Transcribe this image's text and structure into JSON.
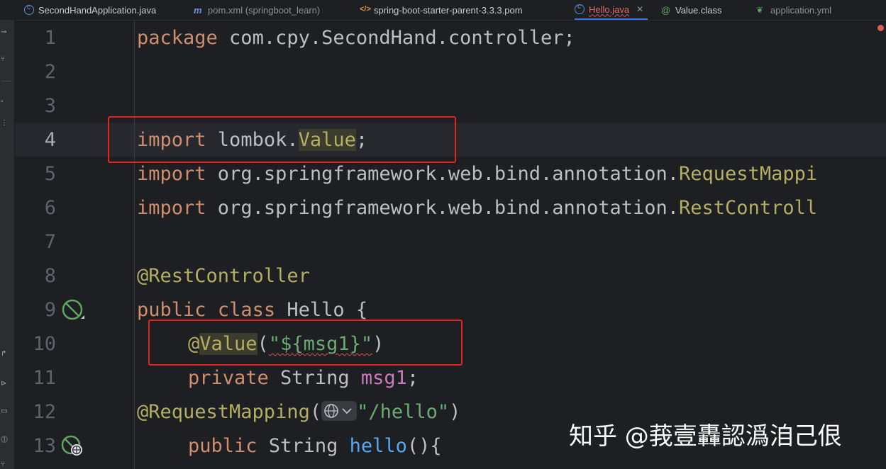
{
  "tabs": [
    {
      "label": "SecondHandApplication.java",
      "icon": "class-icon",
      "color": "#c9ccd3"
    },
    {
      "label": "pom.xml (springboot_learn)",
      "icon": "maven-icon",
      "color": "#8c8f96"
    },
    {
      "label": "spring-boot-starter-parent-3.3.3.pom",
      "icon": "xml-icon",
      "color": "#c9ccd3"
    },
    {
      "label": "Hello.java",
      "icon": "class-icon",
      "color": "#e06c6c",
      "close": "✕"
    },
    {
      "label": "Value.class",
      "icon": "annotation-icon",
      "color": "#c9ccd3"
    },
    {
      "label": "application.yml",
      "icon": "spring-leaf-icon",
      "color": "#8c8f96"
    }
  ],
  "line_numbers": [
    "1",
    "2",
    "3",
    "4",
    "5",
    "6",
    "7",
    "8",
    "9",
    "10",
    "11",
    "12",
    "13"
  ],
  "code": {
    "l1": {
      "kw": "package",
      "rest": " com.cpy.SecondHand.controller;"
    },
    "l4": {
      "kw": "import",
      "mid": " lombok.",
      "cls": "Value",
      "end": ";"
    },
    "l5": {
      "kw": "import",
      "mid": " org.springframework.web.bind.annotation.",
      "cls": "RequestMappi"
    },
    "l6": {
      "kw": "import",
      "mid": " org.springframework.web.bind.annotation.",
      "cls": "RestControll"
    },
    "l8": {
      "ann": "@RestController"
    },
    "l9": {
      "kw1": "public",
      "kw2": "class",
      "rest": " Hello {"
    },
    "l10": {
      "at": "@",
      "ann": "Value",
      "open": "(",
      "str": "\"${msg1}\"",
      "close": ")"
    },
    "l11": {
      "kw": "private",
      "type": " String ",
      "fld": "msg1",
      "end": ";"
    },
    "l12": {
      "ann": "@RequestMapping",
      "open": "(",
      "str": "\"/hello\"",
      "close": ")"
    },
    "l13": {
      "kw": "public",
      "type": " String ",
      "fn": "hello",
      "end": "(){"
    }
  },
  "watermark": "知乎 @莪壹轟認潙洎己佷"
}
